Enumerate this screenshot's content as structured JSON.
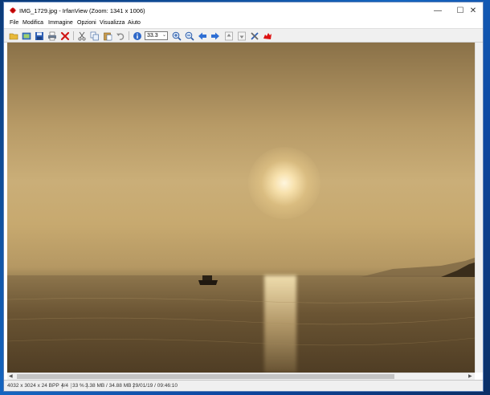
{
  "window": {
    "title": "IMG_1729.jpg - IrfanView (Zoom: 1341 x 1006)",
    "minimize": "—",
    "maximize": "☐",
    "close": "✕"
  },
  "menu": [
    "File",
    "Modifica",
    "Immagine",
    "Opzioni",
    "Visualizza",
    "Aiuto"
  ],
  "toolbar": {
    "zoom_value": "33.3",
    "icons": [
      "open-folder",
      "thumbnails",
      "save",
      "print",
      "delete",
      "cut",
      "copy",
      "paste",
      "undo",
      "info",
      "zoom-in",
      "zoom-out",
      "previous",
      "next",
      "scroll-up",
      "scroll-down",
      "settings",
      "irfanview"
    ]
  },
  "status": {
    "dimensions": "4032 x 3024 x 24 BPP",
    "index": "4/4",
    "zoom": "33 %",
    "size": "3.38 MB / 34.88 MB",
    "datetime": "29/01/19 / 09:46:10"
  },
  "colors": {
    "desktop": "#1565c0",
    "window_border": "#5b7fb5",
    "toolbar_bg": "#f0f0f0",
    "photo_sky": "#c7a96f",
    "photo_sea": "#6a5433"
  }
}
